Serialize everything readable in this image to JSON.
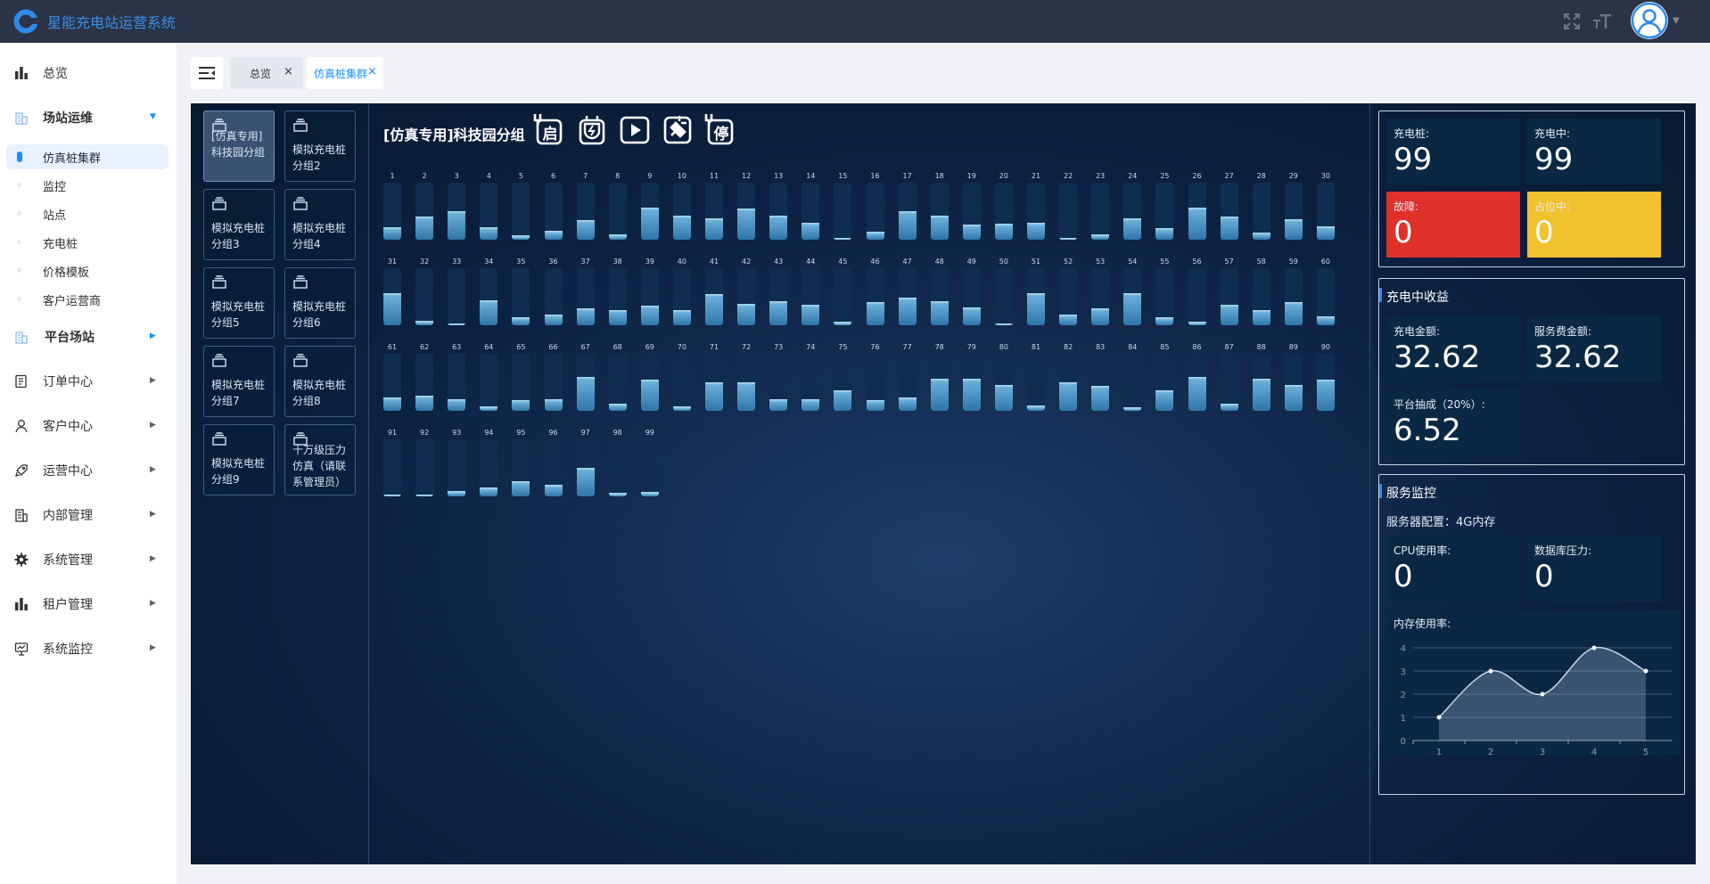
{
  "app": {
    "title": "星能充电站运营系统"
  },
  "sidebar": {
    "overview": "总览",
    "station_ops": "场站运维",
    "station_ops_items": [
      "仿真桩集群",
      "监控",
      "站点",
      "充电桩",
      "价格模板",
      "客户运营商"
    ],
    "platform_station": "平台场站",
    "order_center": "订单中心",
    "customer_center": "客户中心",
    "ops_center": "运营中心",
    "internal_mgmt": "内部管理",
    "system_mgmt": "系统管理",
    "tenant_mgmt": "租户管理",
    "system_monitor": "系统监控"
  },
  "tabs": [
    {
      "label": "总览",
      "close": "×"
    },
    {
      "label": "仿真桩集群",
      "close": "×"
    }
  ],
  "groups": [
    "[仿真专用]科技园分组",
    "模拟充电桩分组2",
    "模拟充电桩分组3",
    "模拟充电桩分组4",
    "模拟充电桩分组5",
    "模拟充电桩分组6",
    "模拟充电桩分组7",
    "模拟充电桩分组8",
    "模拟充电桩分组9",
    "十万级压力仿真（请联系管理员）"
  ],
  "group_title": "[仿真专用]科技园分组",
  "actions": [
    {
      "icon": "plug-start-icon",
      "text": "启"
    },
    {
      "icon": "plug-lightning-icon",
      "text": ""
    },
    {
      "icon": "play-icon",
      "text": ""
    },
    {
      "icon": "plug-connect-icon",
      "text": ""
    },
    {
      "icon": "plug-stop-icon",
      "text": "停"
    }
  ],
  "piles": [
    0.22,
    0.4,
    0.5,
    0.22,
    0.08,
    0.16,
    0.35,
    0.1,
    0.56,
    0.42,
    0.37,
    0.55,
    0.42,
    0.3,
    0.02,
    0.14,
    0.5,
    0.42,
    0.26,
    0.28,
    0.3,
    0.02,
    0.1,
    0.38,
    0.2,
    0.56,
    0.4,
    0.12,
    0.36,
    0.24,
    0.56,
    0.08,
    0.02,
    0.44,
    0.14,
    0.18,
    0.3,
    0.26,
    0.34,
    0.26,
    0.55,
    0.38,
    0.42,
    0.36,
    0.06,
    0.4,
    0.48,
    0.42,
    0.32,
    0.02,
    0.56,
    0.18,
    0.3,
    0.56,
    0.14,
    0.06,
    0.36,
    0.26,
    0.4,
    0.16,
    0.24,
    0.26,
    0.2,
    0.08,
    0.18,
    0.2,
    0.6,
    0.12,
    0.55,
    0.08,
    0.5,
    0.5,
    0.2,
    0.2,
    0.36,
    0.18,
    0.24,
    0.56,
    0.56,
    0.46,
    0.1,
    0.5,
    0.44,
    0.06,
    0.36,
    0.6,
    0.12,
    0.56,
    0.46,
    0.54,
    0.02,
    0.02,
    0.1,
    0.16,
    0.26,
    0.2,
    0.5,
    0.06,
    0.08
  ],
  "counts": {
    "pile_label": "充电桩:",
    "pile_value": "99",
    "charging_label": "充电中:",
    "charging_value": "99",
    "fault_label": "故障:",
    "fault_value": "0",
    "occupied_label": "占位中:",
    "occupied_value": "0"
  },
  "income": {
    "title": "充电中收益",
    "charge_amount_label": "充电金额:",
    "charge_amount_value": "32.62",
    "service_fee_label": "服务费金额:",
    "service_fee_value": "32.62",
    "platform_cut_label": "平台抽成（20%）:",
    "platform_cut_value": "6.52"
  },
  "monitor": {
    "title": "服务监控",
    "server_config": "服务器配置：4G内存",
    "cpu_label": "CPU使用率:",
    "cpu_value": "0",
    "db_label": "数据库压力:",
    "db_value": "0",
    "mem_label": "内存使用率:"
  },
  "chart_data": {
    "type": "area",
    "x": [
      1,
      2,
      3,
      4,
      5
    ],
    "values": [
      1,
      3,
      2,
      4,
      3
    ],
    "ylim": [
      0,
      4
    ],
    "yticks": [
      0,
      1,
      2,
      3,
      4
    ],
    "grid": true,
    "title": "",
    "xlabel": "",
    "ylabel": ""
  },
  "colors": {
    "fault": "#e0302a",
    "occupied": "#f2c12e",
    "accent": "#1890ff",
    "brand": "#3a8ee6"
  }
}
